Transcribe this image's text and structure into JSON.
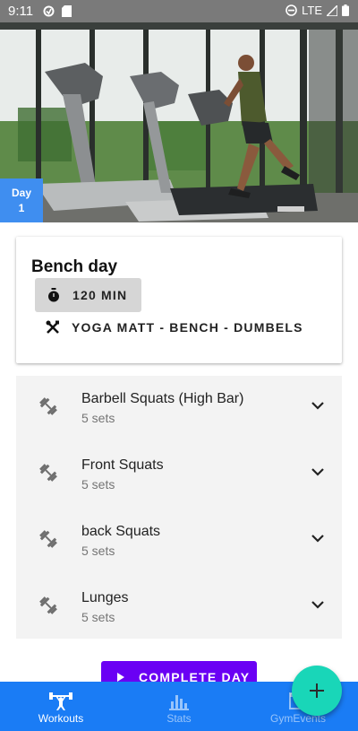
{
  "status_bar": {
    "time": "9:11",
    "network": "LTE"
  },
  "workout": {
    "day_label": "Day",
    "day_number": "1",
    "title": "Bench day",
    "duration": "120 MIN",
    "equipment": "YOGA MATT - BENCH - DUMBELS"
  },
  "exercises": [
    {
      "name": "Barbell Squats (High Bar)",
      "sets": "5 sets"
    },
    {
      "name": "Front Squats",
      "sets": "5 sets"
    },
    {
      "name": "back Squats",
      "sets": "5 sets"
    },
    {
      "name": "Lunges",
      "sets": "5 sets"
    }
  ],
  "complete_button": {
    "label": "COMPLETE DAY"
  },
  "bottom_nav": [
    {
      "label": "Workouts",
      "active": true,
      "icon": "weightlifter-icon"
    },
    {
      "label": "Stats",
      "active": false,
      "icon": "bar-chart-icon"
    },
    {
      "label": "GymEvents",
      "active": false,
      "icon": "calendar-icon"
    }
  ],
  "fab": {
    "icon": "plus-icon"
  },
  "colors": {
    "nav_bg": "#1a7cf5",
    "accent_button": "#6a00f4",
    "fab": "#19d6b8",
    "day_badge": "#3f8ef0"
  }
}
